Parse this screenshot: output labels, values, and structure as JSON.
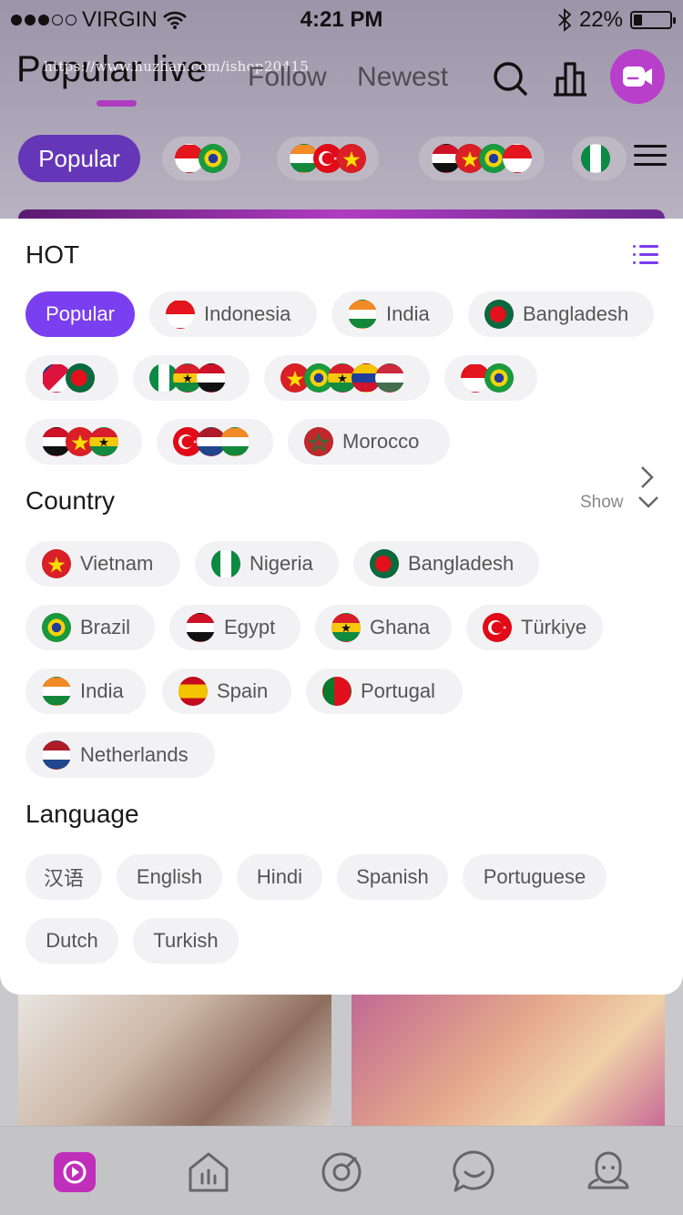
{
  "status": {
    "carrier": "VIRGIN",
    "time": "4:21 PM",
    "battery": "22%",
    "battery_level": 0.22
  },
  "nav": {
    "tabs": [
      "Popular live",
      "Follow",
      "Newest"
    ],
    "watermark": "https://www.huzhan.com/ishop20415"
  },
  "chip_row": {
    "popular": "Popular"
  },
  "panel": {
    "hot": {
      "title": "HOT",
      "items": [
        {
          "label": "Popular"
        },
        {
          "label": "Indonesia",
          "flags": [
            "indonesia"
          ]
        },
        {
          "label": "India",
          "flags": [
            "india"
          ]
        },
        {
          "label": "Bangladesh",
          "flags": [
            "bangladesh"
          ]
        },
        {
          "label": "",
          "flags": [
            "nepal",
            "bangladesh"
          ]
        },
        {
          "label": "",
          "flags": [
            "nigeria",
            "ghana",
            "egypt"
          ]
        },
        {
          "label": "",
          "flags": [
            "vietnam",
            "brazil",
            "ghana",
            "venezuela",
            "hungary"
          ]
        },
        {
          "label": "",
          "flags": [
            "indonesia",
            "brazil"
          ]
        },
        {
          "label": "",
          "flags": [
            "egypt",
            "vietnam",
            "ghana"
          ]
        },
        {
          "label": "",
          "flags": [
            "turkey",
            "netherlands",
            "india"
          ]
        },
        {
          "label": "Morocco",
          "flags": [
            "morocco"
          ]
        }
      ]
    },
    "country": {
      "title": "Country",
      "show_label": "Show",
      "items": [
        {
          "label": "Vietnam",
          "flag": "vietnam"
        },
        {
          "label": "Nigeria",
          "flag": "nigeria"
        },
        {
          "label": "Bangladesh",
          "flag": "bangladesh"
        },
        {
          "label": "Brazil",
          "flag": "brazil"
        },
        {
          "label": "Egypt",
          "flag": "egypt"
        },
        {
          "label": "Ghana",
          "flag": "ghana"
        },
        {
          "label": "Türkiye",
          "flag": "turkey"
        },
        {
          "label": "India",
          "flag": "india"
        },
        {
          "label": "Spain",
          "flag": "spain"
        },
        {
          "label": "Portugal",
          "flag": "portugal"
        },
        {
          "label": "Netherlands",
          "flag": "netherlands"
        }
      ]
    },
    "language": {
      "title": "Language",
      "items": [
        "汉语",
        "English",
        "Hindi",
        "Spanish",
        "Portuguese",
        "Dutch",
        "Turkish"
      ]
    }
  },
  "bottom_nav": [
    "live-icon",
    "home-icon",
    "discover-icon",
    "chat-icon",
    "profile-icon"
  ],
  "colors": {
    "accent": "#7a3ff0",
    "live": "#b73fc9"
  }
}
